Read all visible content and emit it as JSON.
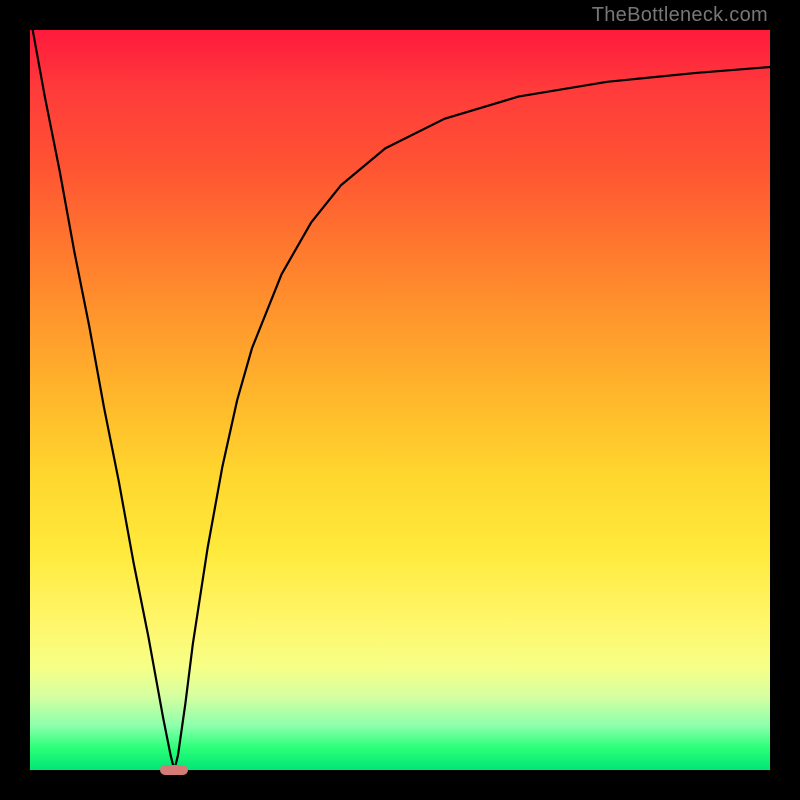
{
  "watermark": "TheBottleneck.com",
  "chart_data": {
    "type": "line",
    "title": "",
    "xlabel": "",
    "ylabel": "",
    "x": [
      0,
      2,
      4,
      6,
      8,
      10,
      12,
      14,
      16,
      18,
      19,
      19.5,
      20,
      21,
      22,
      24,
      26,
      28,
      30,
      34,
      38,
      42,
      48,
      56,
      66,
      78,
      90,
      100
    ],
    "values": [
      102,
      91,
      81,
      70,
      60,
      49,
      39,
      28,
      18,
      7,
      2,
      0,
      2,
      9,
      17,
      30,
      41,
      50,
      57,
      67,
      74,
      79,
      84,
      88,
      91,
      93,
      94.2,
      95
    ],
    "ylim": [
      0,
      100
    ],
    "xlim": [
      0,
      100
    ],
    "marker": {
      "x": 19.5,
      "y": 0
    },
    "background_gradient": {
      "top": "#ff1a3c",
      "bottom": "#00e676"
    }
  }
}
